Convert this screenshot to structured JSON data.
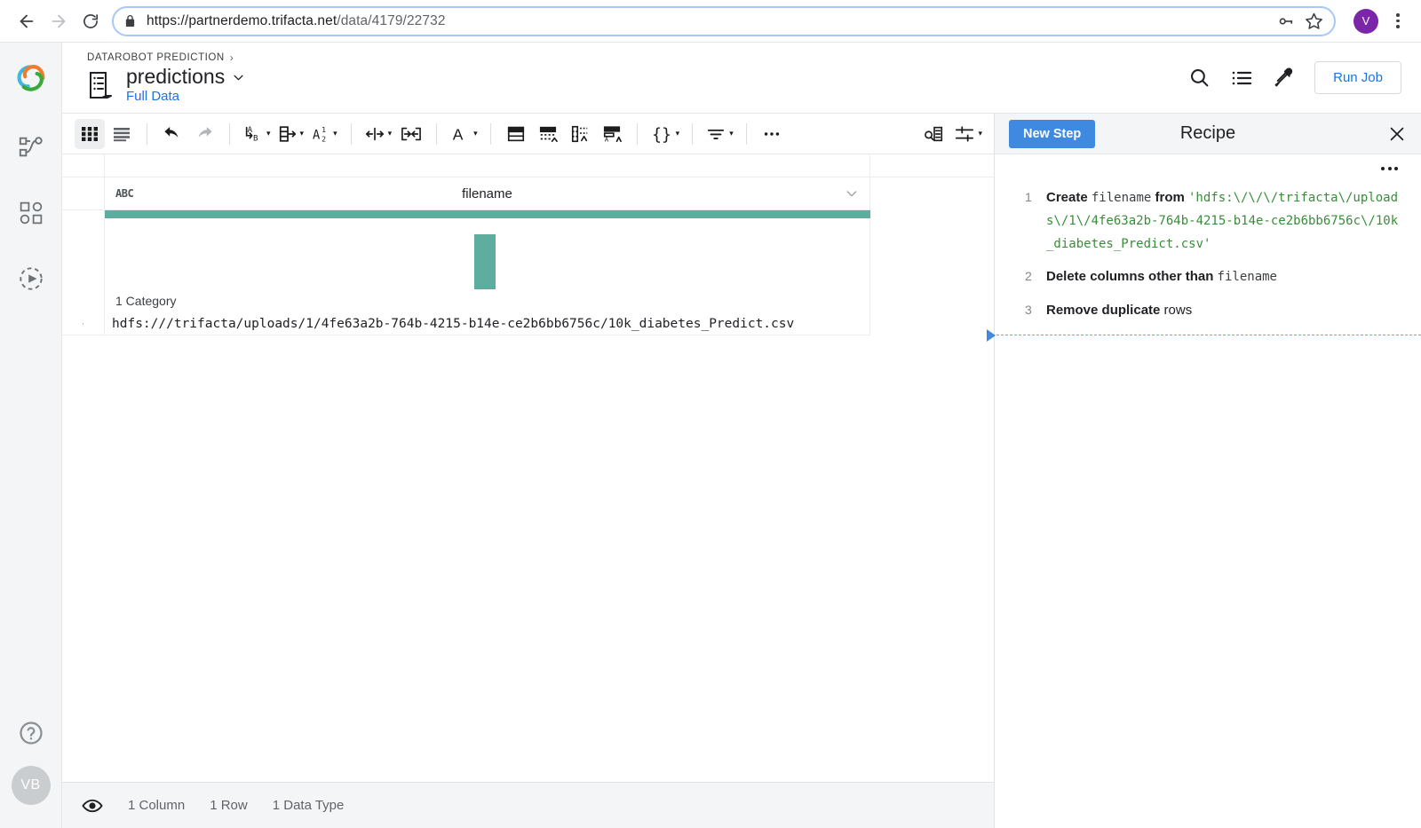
{
  "browser": {
    "url_scheme_host": "https://partnerdemo.trifacta.net",
    "url_path": "/data/4179/22732",
    "back_icon": "back-arrow-icon",
    "forward_icon": "forward-arrow-icon",
    "reload_icon": "reload-icon",
    "lock_icon": "lock-icon",
    "password_icon": "key-icon",
    "bookmark_icon": "star-icon",
    "profile_initial": "V",
    "profile_color": "#7b26a8",
    "menu_icon": "kebab-menu-icon"
  },
  "rail": {
    "logo": "trifacta-logo",
    "items": [
      {
        "name": "flows-icon"
      },
      {
        "name": "library-icon"
      },
      {
        "name": "jobs-icon"
      }
    ],
    "help_icon": "help-circle-icon",
    "avatar_initials": "VB"
  },
  "header": {
    "breadcrumb": "DATAROBOT PREDICTION",
    "breadcrumb_sep": "›",
    "doc_icon": "dataset-icon",
    "title": "predictions",
    "title_caret": "chevron-down-icon",
    "subtitle": "Full Data",
    "search_icon": "search-icon",
    "column_list_icon": "column-browser-icon",
    "eyedropper_icon": "eyedropper-icon",
    "run_job_label": "Run Job"
  },
  "toolbar": {
    "groups": [
      {
        "items": [
          {
            "name": "grid-view-button",
            "icon": "grid-icon",
            "active": true,
            "caret": false
          },
          {
            "name": "list-view-button",
            "icon": "list-lines-icon",
            "active": false,
            "caret": false
          }
        ]
      },
      {
        "items": [
          {
            "name": "undo-button",
            "icon": "undo-icon",
            "active": false,
            "caret": false
          },
          {
            "name": "redo-button",
            "icon": "redo-icon",
            "active": false,
            "caret": false
          }
        ]
      },
      {
        "items": [
          {
            "name": "replace-button",
            "icon": "a-to-b-icon",
            "active": false,
            "caret": true
          },
          {
            "name": "extract-button",
            "icon": "extract-icon",
            "active": false,
            "caret": true
          },
          {
            "name": "count-button",
            "icon": "a-1-2-icon",
            "active": false,
            "caret": false
          }
        ]
      },
      {
        "items": [
          {
            "name": "split-button",
            "icon": "split-arrows-icon",
            "active": false,
            "caret": true
          },
          {
            "name": "merge-button",
            "icon": "merge-brackets-icon",
            "active": false,
            "caret": false
          }
        ]
      },
      {
        "items": [
          {
            "name": "format-button",
            "icon": "letter-a-icon",
            "active": false,
            "caret": true
          }
        ]
      },
      {
        "items": [
          {
            "name": "pivot-button",
            "icon": "pivot-table-icon",
            "active": false,
            "caret": false
          },
          {
            "name": "unpivot-button",
            "icon": "unpivot-icon",
            "active": false,
            "caret": false
          },
          {
            "name": "transpose-button",
            "icon": "transpose-icon",
            "active": false,
            "caret": false
          },
          {
            "name": "sort-rows-button",
            "icon": "sort-rows-icon",
            "active": false,
            "caret": false
          }
        ]
      },
      {
        "items": [
          {
            "name": "nest-button",
            "icon": "curly-braces-icon",
            "active": false,
            "caret": true
          }
        ]
      },
      {
        "items": [
          {
            "name": "filter-button",
            "icon": "filter-icon",
            "active": false,
            "caret": true
          }
        ]
      },
      {
        "items": [
          {
            "name": "more-transforms-button",
            "icon": "ellipsis-icon",
            "active": false,
            "caret": false
          }
        ]
      }
    ],
    "right_items": [
      {
        "name": "find-replace-button",
        "icon": "magnify-column-icon",
        "caret": false
      },
      {
        "name": "display-settings-button",
        "icon": "sliders-icon",
        "caret": true
      }
    ]
  },
  "grid": {
    "column": {
      "data_type": "ABC",
      "name": "filename",
      "menu_icon": "chevron-down-icon",
      "quality_color": "#5fad9f",
      "category_summary": "1 Category"
    },
    "histogram": {
      "bar_color": "#5fad9f",
      "bars": [
        {
          "label": "hdfs:///trifacta/uploads/1/4fe63a2b-764b-4215-b14e-ce2b6bb6756c/10k_diabetes_Predict.csv",
          "count": 1
        }
      ]
    },
    "rows": [
      {
        "marker": "·",
        "filename": "hdfs:///trifacta/uploads/1/4fe63a2b-764b-4215-b14e-ce2b6bb6756c/10k_diabetes_Predict.csv"
      }
    ]
  },
  "status": {
    "eye_icon": "eye-icon",
    "columns": "1 Column",
    "rows": "1 Row",
    "data_types": "1 Data Type"
  },
  "recipe": {
    "new_step_label": "New Step",
    "title": "Recipe",
    "close_icon": "close-icon",
    "options_icon": "ellipsis-icon",
    "accent_color": "#3f8ae0",
    "steps": [
      {
        "num": "1",
        "verb": "Create",
        "target": "filename",
        "connector": "from",
        "value": "'hdfs:\\/\\/\\/trifacta\\/uploads\\/1\\/4fe63a2b-764b-4215-b14e-ce2b6bb6756c\\/10k_diabetes_Predict.csv'"
      },
      {
        "num": "2",
        "verb": "Delete columns other than",
        "target": "filename",
        "connector": "",
        "value": ""
      },
      {
        "num": "3",
        "verb": "Remove duplicate",
        "target": "",
        "connector": "rows",
        "value": ""
      }
    ]
  }
}
